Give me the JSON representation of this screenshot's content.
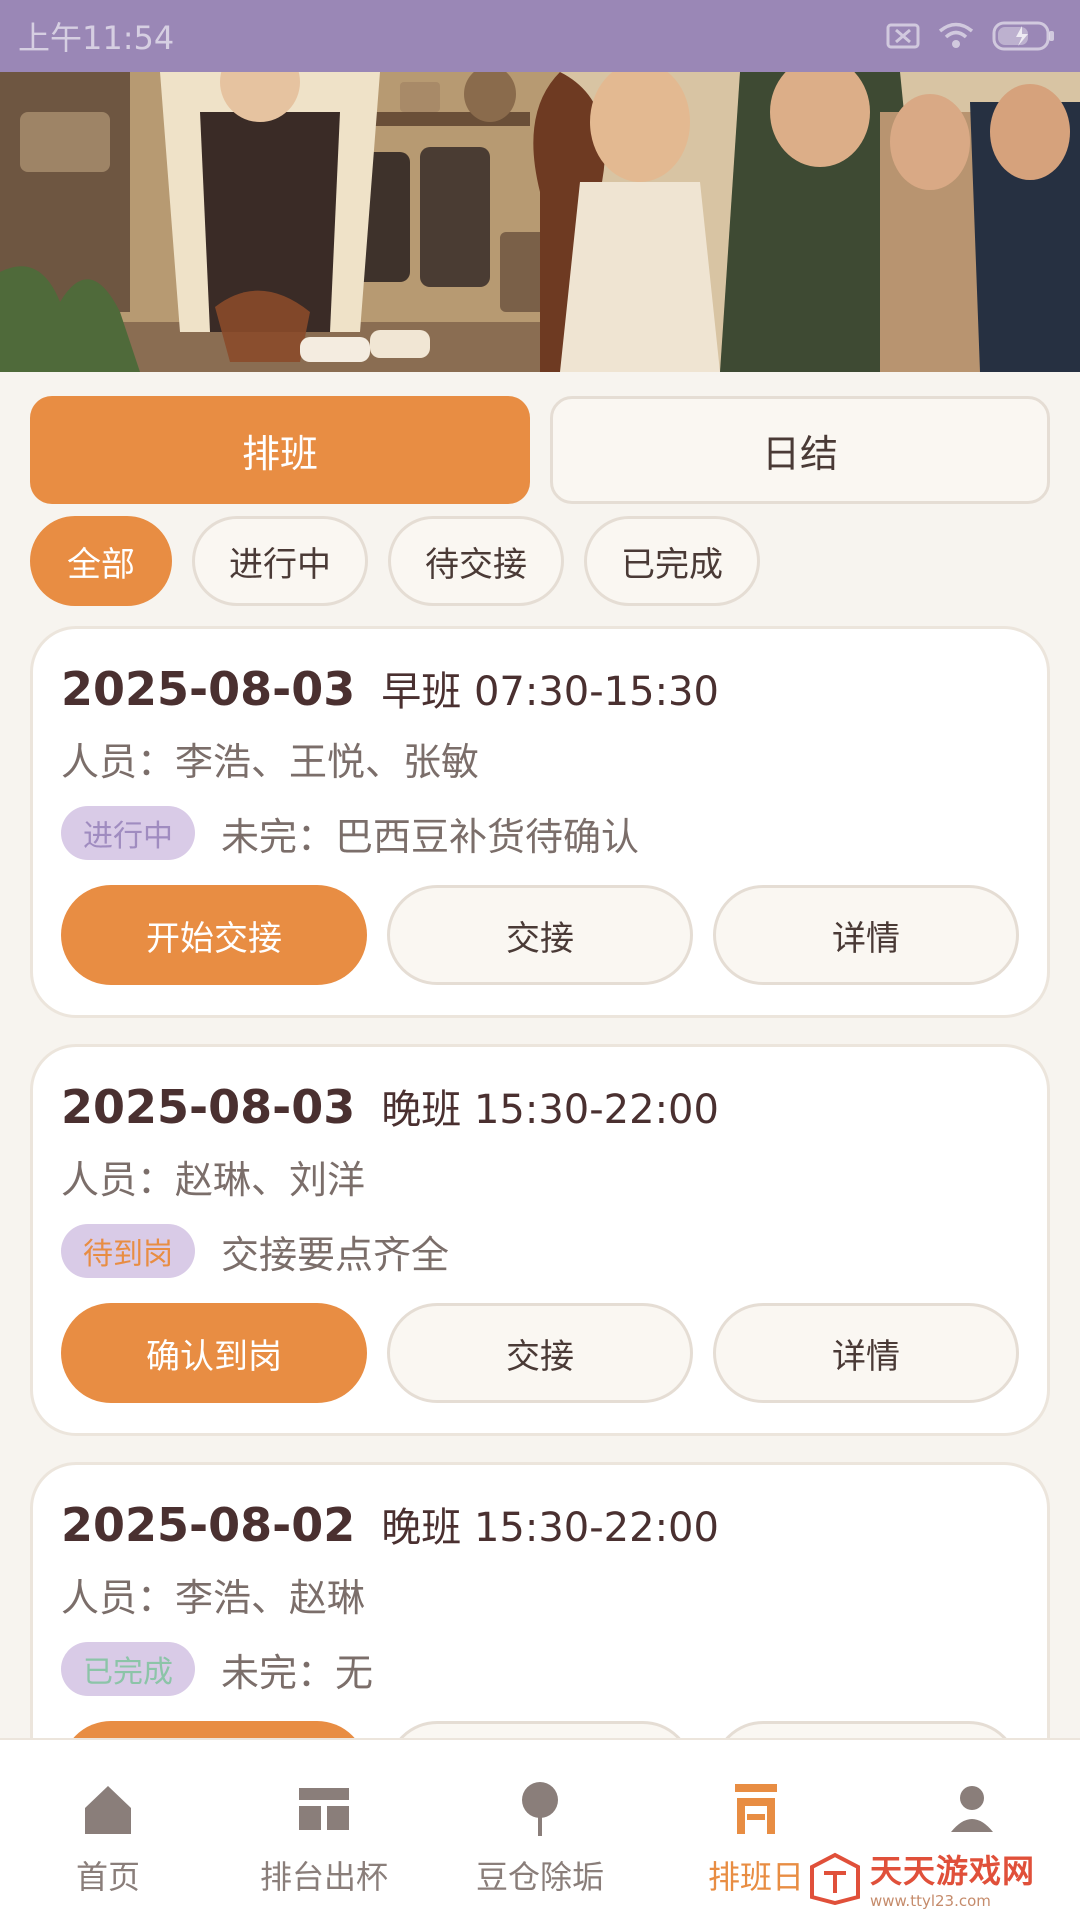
{
  "status_bar": {
    "time": "上午11:54"
  },
  "hero": {
    "icon": "cafe-illustration"
  },
  "tabs": [
    {
      "label": "排班",
      "active": true
    },
    {
      "label": "日结",
      "active": false
    }
  ],
  "filters": [
    {
      "label": "全部",
      "active": true
    },
    {
      "label": "进行中",
      "active": false
    },
    {
      "label": "待交接",
      "active": false
    },
    {
      "label": "已完成",
      "active": false
    }
  ],
  "shifts": [
    {
      "date": "2025-08-03",
      "shift": "早班 07:30-15:30",
      "staff": "人员：李浩、王悦、张敏",
      "badge": "进行中",
      "badge_color": "#a08cc0",
      "note": "未完：巴西豆补货待确认",
      "primary_action": "开始交接",
      "handover_label": "交接",
      "details_label": "详情"
    },
    {
      "date": "2025-08-03",
      "shift": "晚班 15:30-22:00",
      "staff": "人员：赵琳、刘洋",
      "badge": "待到岗",
      "badge_color": "#e88d43",
      "note": "交接要点齐全",
      "primary_action": "确认到岗",
      "handover_label": "交接",
      "details_label": "详情"
    },
    {
      "date": "2025-08-02",
      "shift": "晚班 15:30-22:00",
      "staff": "人员：李浩、赵琳",
      "badge": "已完成",
      "badge_color": "#8cc4a8",
      "note": "未完：无",
      "primary_action": "",
      "handover_label": "",
      "details_label": ""
    }
  ],
  "bottom_nav": [
    {
      "label": "首页",
      "icon": "home-icon",
      "active": false
    },
    {
      "label": "排台出杯",
      "icon": "counter-icon",
      "active": false
    },
    {
      "label": "豆仓除垢",
      "icon": "bean-icon",
      "active": false
    },
    {
      "label": "排班日",
      "icon": "schedule-icon",
      "active": true
    },
    {
      "label": "",
      "icon": "profile-icon",
      "active": false
    }
  ],
  "watermark": {
    "title": "天天游戏网",
    "url": "www.ttyl23.com"
  },
  "colors": {
    "accent": "#e88d43",
    "status_bar": "#9a87b6",
    "background": "#f7f4ef"
  }
}
